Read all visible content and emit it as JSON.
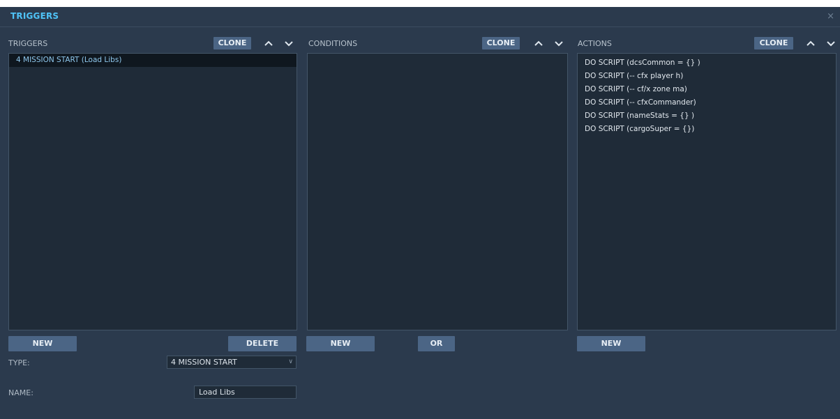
{
  "window": {
    "title": "TRIGGERS",
    "close_glyph": "×"
  },
  "triggers": {
    "header": "TRIGGERS",
    "clone_label": "CLONE",
    "items": [
      {
        "label": "4 MISSION START (Load Libs)",
        "selected": true
      }
    ],
    "new_label": "NEW",
    "delete_label": "DELETE"
  },
  "conditions": {
    "header": "CONDITIONS",
    "clone_label": "CLONE",
    "items": [],
    "new_label": "NEW",
    "or_label": "OR"
  },
  "actions": {
    "header": "ACTIONS",
    "clone_label": "CLONE",
    "items": [
      {
        "label": "DO SCRIPT (dcsCommon = {} )"
      },
      {
        "label": "DO SCRIPT (-- cfx player h)"
      },
      {
        "label": "DO SCRIPT (-- cf/x zone ma)"
      },
      {
        "label": "DO SCRIPT (-- cfxCommander)"
      },
      {
        "label": "DO SCRIPT (nameStats = {} )"
      },
      {
        "label": "DO SCRIPT (cargoSuper = {})"
      }
    ],
    "new_label": "NEW"
  },
  "form": {
    "type_label": "TYPE:",
    "type_value": "4 MISSION START",
    "name_label": "NAME:",
    "name_value": "Load Libs"
  },
  "icons": {
    "up": "chevron-up-icon",
    "down": "chevron-down-icon",
    "close": "close-icon"
  },
  "colors": {
    "background": "#2b3a4d",
    "title": "#4fc3f7",
    "button": "#4b6585",
    "list": "#1f2b38",
    "selected_text": "#8fc7ec"
  }
}
